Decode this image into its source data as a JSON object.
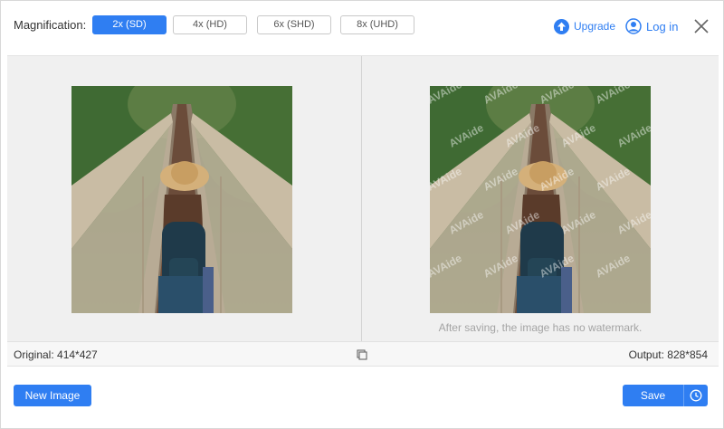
{
  "toolbar": {
    "magnification_label": "Magnification:",
    "options": [
      "2x (SD)",
      "4x (HD)",
      "6x (SHD)",
      "8x (UHD)"
    ],
    "selected": "2x (SD)",
    "upgrade_label": "Upgrade",
    "login_label": "Log in",
    "icons": {
      "upgrade": "upgrade-arrow-icon",
      "login": "user-icon",
      "close": "close-icon"
    }
  },
  "preview": {
    "watermark_text": "AVAide",
    "note": "After saving, the image has no watermark."
  },
  "info": {
    "original": "Original: 414*427",
    "output": "Output: 828*854"
  },
  "actions": {
    "new_image_label": "New Image",
    "save_label": "Save",
    "history_icon": "clock-icon"
  },
  "colors": {
    "accent": "#2f7ef2",
    "preview_bg": "#f0f0f0"
  }
}
